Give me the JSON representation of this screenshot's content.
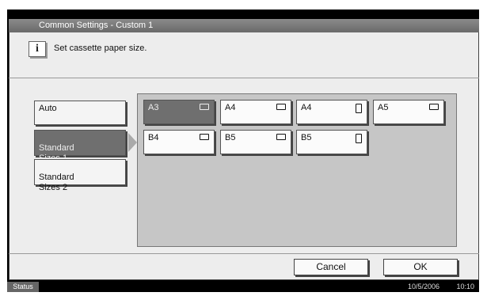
{
  "window": {
    "title": "Common Settings - Custom 1"
  },
  "info": {
    "message": "Set cassette paper size."
  },
  "side_buttons": [
    {
      "label": "Auto"
    },
    {
      "label": "Standard\nSizes 1"
    },
    {
      "label": "Standard\nSizes 2"
    }
  ],
  "paper_sizes": [
    {
      "label": "A3",
      "orientation": "landscape"
    },
    {
      "label": "A4",
      "orientation": "landscape"
    },
    {
      "label": "A4",
      "orientation": "portrait"
    },
    {
      "label": "A5",
      "orientation": "landscape"
    },
    {
      "label": "B4",
      "orientation": "landscape"
    },
    {
      "label": "B5",
      "orientation": "landscape"
    },
    {
      "label": "B5",
      "orientation": "portrait"
    }
  ],
  "actions": {
    "cancel": "Cancel",
    "ok": "OK"
  },
  "status": {
    "label": "Status",
    "date": "10/5/2006",
    "time": "10:10"
  }
}
